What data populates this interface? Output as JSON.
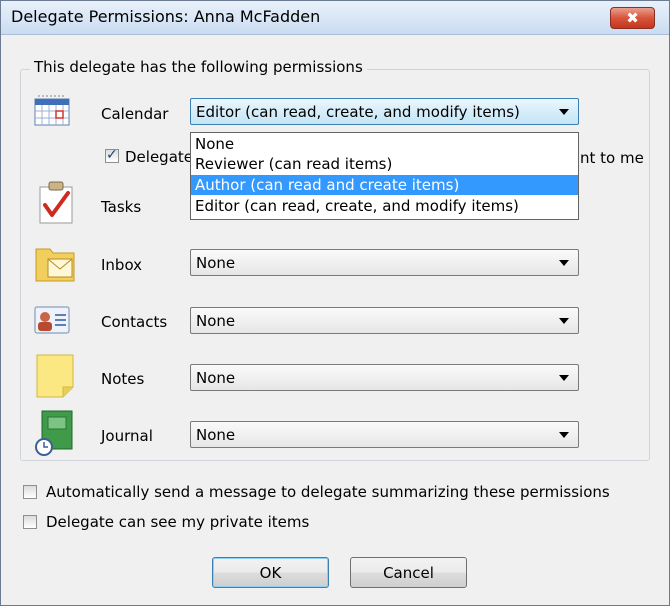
{
  "window": {
    "title": "Delegate Permissions: Anna McFadden",
    "close_glyph": "✖"
  },
  "group": {
    "label": "This delegate has the following permissions"
  },
  "rows": [
    {
      "label": "Calendar",
      "value": "Editor (can read, create, and modify items)",
      "icon": "calendar-icon"
    },
    {
      "label": "Tasks",
      "value": "",
      "icon": "tasks-icon"
    },
    {
      "label": "Inbox",
      "value": "None",
      "icon": "inbox-icon"
    },
    {
      "label": "Contacts",
      "value": "None",
      "icon": "contacts-icon"
    },
    {
      "label": "Notes",
      "value": "None",
      "icon": "notes-icon"
    },
    {
      "label": "Journal",
      "value": "None",
      "icon": "journal-icon"
    }
  ],
  "delegate_checkbox": {
    "label_left": "Delegate",
    "label_right": "nt to me",
    "checked": true
  },
  "dropdown": {
    "options": [
      "None",
      "Reviewer (can read items)",
      "Author (can read and create items)",
      "Editor (can read, create, and modify items)"
    ],
    "highlighted_index": 2
  },
  "options": {
    "auto_send": {
      "label": "Automatically send a message to delegate summarizing these permissions",
      "checked": false
    },
    "private_items": {
      "label": "Delegate can see my private items",
      "checked": false
    }
  },
  "buttons": {
    "ok": "OK",
    "cancel": "Cancel"
  },
  "colors": {
    "highlight": "#3399ff",
    "titlebar": "#d8e6f6",
    "close": "#c2361c"
  }
}
